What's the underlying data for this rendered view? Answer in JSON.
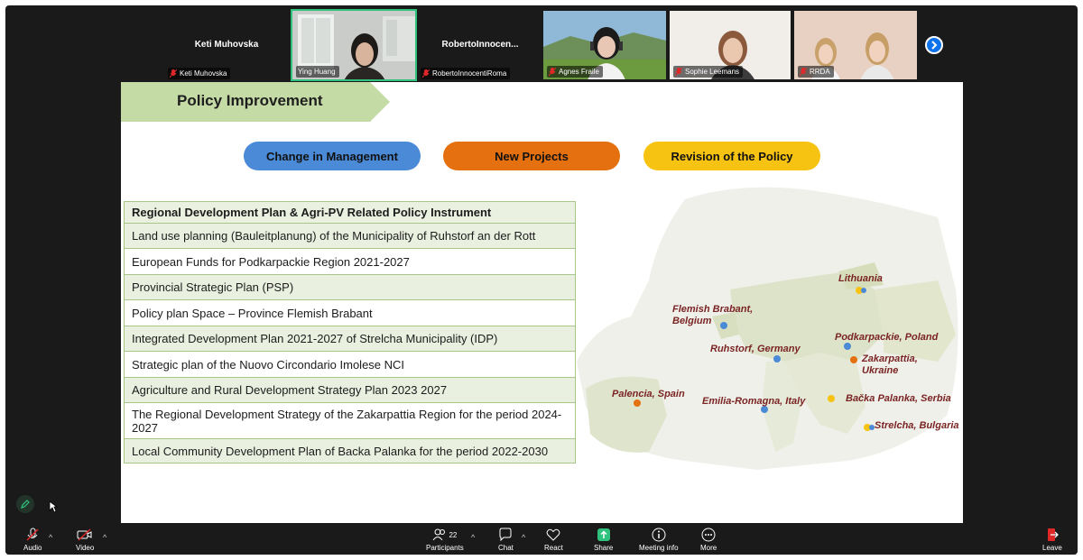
{
  "participants": [
    {
      "name": "Keti Muhovska",
      "label": "Keti Muhovska",
      "video": false
    },
    {
      "name": "Ying Huang",
      "label": "Ying Huang",
      "video": true,
      "active": true
    },
    {
      "name": "RobertoInnocen...",
      "label": "RobertoInnocentiRoma",
      "video": false
    },
    {
      "name": "Agnes Fraile",
      "label": "Agnes Fraile",
      "video": true
    },
    {
      "name": "Sophie Leemans",
      "label": "Sophie Leemans",
      "video": true
    },
    {
      "name": "RRDA",
      "label": "RRDA",
      "video": true
    }
  ],
  "slide": {
    "title": "Policy Improvement",
    "pills": [
      {
        "label": "Change in Management",
        "color": "#4a8ad6"
      },
      {
        "label": "New Projects",
        "color": "#e5700f"
      },
      {
        "label": "Revision of the Policy",
        "color": "#f7c313"
      }
    ],
    "table": {
      "header": "Regional Development Plan & Agri-PV Related Policy Instrument",
      "rows": [
        "Land use planning (Bauleitplanung) of the Municipality of Ruhstorf an der Rott",
        "European Funds for Podkarpackie Region 2021-2027",
        "Provincial Strategic Plan (PSP)",
        "Policy plan Space – Province Flemish Brabant",
        "Integrated Development Plan 2021-2027 of Strelcha Municipality (IDP)",
        "Strategic plan of the Nuovo Circondario Imolese NCI",
        "Agriculture and Rural Development Strategy Plan 2023 2027",
        "The Regional Development Strategy of the Zakarpattia Region for the period 2024-2027",
        "Local Community Development Plan of Backa Palanka for the period 2022-2030"
      ]
    },
    "map_labels": [
      {
        "text": "Lithuania",
        "color": "#f7c313"
      },
      {
        "text": "Flemish Brabant, Belgium",
        "color": "#4a8ad6"
      },
      {
        "text": "Ruhstorf, Germany",
        "color": "#4a8ad6"
      },
      {
        "text": "Podkarpackie, Poland",
        "color": "#4a8ad6"
      },
      {
        "text": "Zakarpattia, Ukraine",
        "color": "#e5700f"
      },
      {
        "text": "Palencia, Spain",
        "color": "#e5700f"
      },
      {
        "text": "Emilia-Romagna, Italy",
        "color": "#4a8ad6"
      },
      {
        "text": "Bačka Palanka, Serbia",
        "color": "#f7c313"
      },
      {
        "text": "Strelcha, Bulgaria",
        "color": "#f7c313"
      }
    ]
  },
  "toolbar": {
    "audio": "Audio",
    "video": "Video",
    "participants": "Participants",
    "participants_count": "22",
    "chat": "Chat",
    "react": "React",
    "share": "Share",
    "meeting_info": "Meeting info",
    "more": "More",
    "leave": "Leave"
  },
  "colors": {
    "share": "#2ec27e",
    "leave": "#e02828",
    "accent": "#0e72ed"
  }
}
